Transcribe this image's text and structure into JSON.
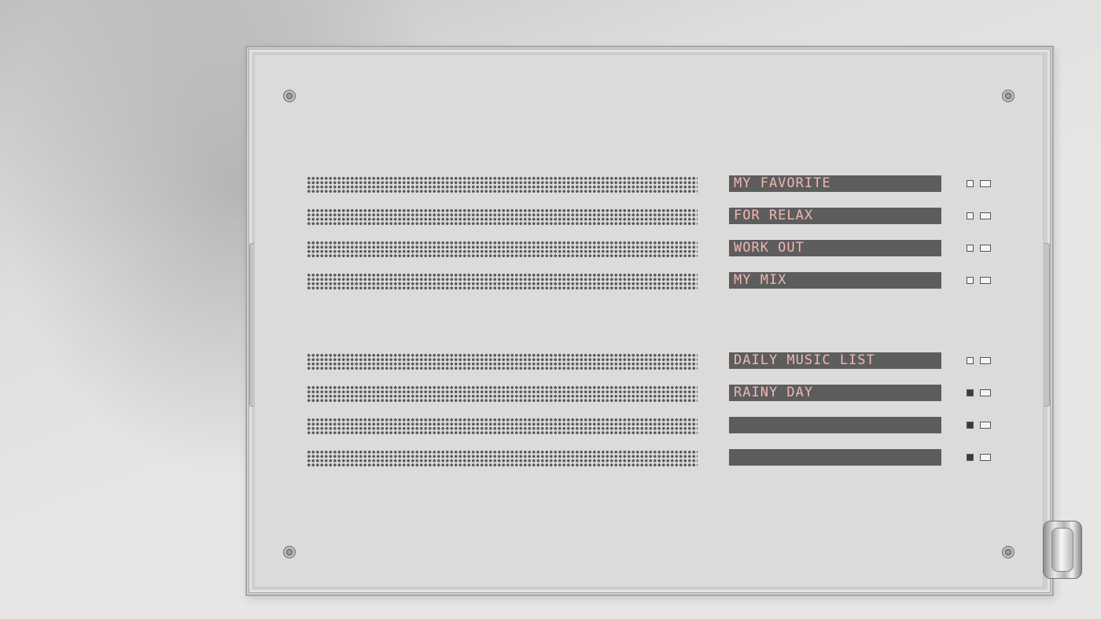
{
  "playlists": [
    {
      "label": "MY FAVORITE",
      "indicator_on": false
    },
    {
      "label": "FOR RELAX",
      "indicator_on": false
    },
    {
      "label": "WORK OUT",
      "indicator_on": false
    },
    {
      "label": "MY MIX",
      "indicator_on": false
    },
    {
      "label": "DAILY MUSIC LIST",
      "indicator_on": false
    },
    {
      "label": "RAINY DAY",
      "indicator_on": true
    },
    {
      "label": "",
      "indicator_on": true
    },
    {
      "label": "",
      "indicator_on": true
    }
  ],
  "colors": {
    "display_background": "#5d5d5d",
    "display_text": "#f0b7b0",
    "panel": "#dcdbd9"
  },
  "icons": [
    "screw-icon",
    "speaker-grille",
    "volume-knob"
  ]
}
